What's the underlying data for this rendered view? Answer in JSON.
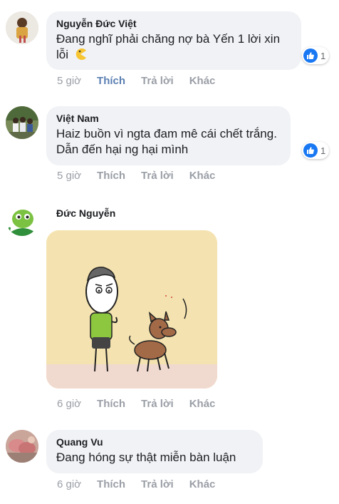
{
  "comments": [
    {
      "author": "Nguyễn Đức Việt",
      "text_line1": "Đang nghĩ phải chăng nợ bà Yến 1 lời xin",
      "text_line2": "lỗi",
      "emoji_icon": "pacman-emoji-icon",
      "reaction_count": "1",
      "time": "5 giờ",
      "like": "Thích",
      "reply": "Trả lời",
      "more": "Khác"
    },
    {
      "author": "Việt Nam",
      "text_line1": "Haiz buồn vì ngta đam mê cái chết trắng.",
      "text_line2": "Dẫn đến hại ng hại mình",
      "reaction_count": "1",
      "time": "5 giờ",
      "like": "Thích",
      "reply": "Trả lời",
      "more": "Khác"
    },
    {
      "author": "Đức Nguyễn",
      "sticker": "cartoon-man-and-dog-sticker",
      "time": "6 giờ",
      "like": "Thích",
      "reply": "Trả lời",
      "more": "Khác"
    },
    {
      "author": "Quang Vu",
      "text_line1": "Đang hóng sự thật miễn bàn luận",
      "time": "6 giờ",
      "like": "Thích",
      "reply": "Trả lời",
      "more": "Khác"
    }
  ],
  "colors": {
    "like_blue": "#1877f2",
    "liked_text": "#5b7fb2",
    "bubble_bg": "#f0f2f5",
    "meta_gray": "#9a9ea6"
  }
}
